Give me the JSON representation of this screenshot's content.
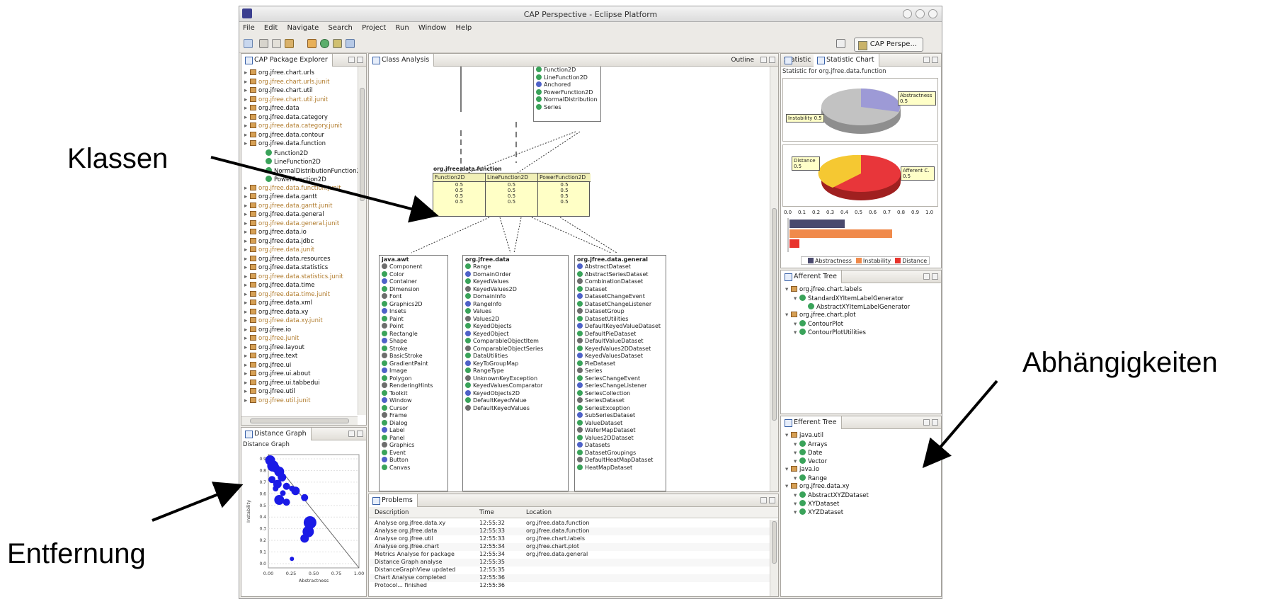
{
  "callouts": {
    "classes": "Klassen",
    "dependencies": "Abhängigkeiten",
    "distance": "Entfernung"
  },
  "window": {
    "title": "CAP Perspective - Eclipse Platform",
    "menu": [
      "File",
      "Edit",
      "Navigate",
      "Search",
      "Project",
      "Run",
      "Window",
      "Help"
    ],
    "perspective_button": "CAP Perspe..."
  },
  "package_explorer": {
    "tab": "CAP Package Explorer",
    "items": [
      {
        "label": "org.jfree.chart.urls",
        "kind": "package"
      },
      {
        "label": "org.jfree.chart.urls.junit",
        "kind": "package"
      },
      {
        "label": "org.jfree.chart.util",
        "kind": "package"
      },
      {
        "label": "org.jfree.chart.util.junit",
        "kind": "package"
      },
      {
        "label": "org.jfree.data",
        "kind": "package"
      },
      {
        "label": "org.jfree.data.category",
        "kind": "package"
      },
      {
        "label": "org.jfree.data.category.junit",
        "kind": "package"
      },
      {
        "label": "org.jfree.data.contour",
        "kind": "package"
      },
      {
        "label": "org.jfree.data.function",
        "kind": "package"
      },
      {
        "label": "Function2D",
        "kind": "class"
      },
      {
        "label": "LineFunction2D",
        "kind": "class"
      },
      {
        "label": "NormalDistributionFunction2D",
        "kind": "class"
      },
      {
        "label": "PowerFunction2D",
        "kind": "class"
      },
      {
        "label": "org.jfree.data.function.junit",
        "kind": "package"
      },
      {
        "label": "org.jfree.data.gantt",
        "kind": "package"
      },
      {
        "label": "org.jfree.data.gantt.junit",
        "kind": "package"
      },
      {
        "label": "org.jfree.data.general",
        "kind": "package"
      },
      {
        "label": "org.jfree.data.general.junit",
        "kind": "package"
      },
      {
        "label": "org.jfree.data.io",
        "kind": "package"
      },
      {
        "label": "org.jfree.data.jdbc",
        "kind": "package"
      },
      {
        "label": "org.jfree.data.junit",
        "kind": "package"
      },
      {
        "label": "org.jfree.data.resources",
        "kind": "package"
      },
      {
        "label": "org.jfree.data.statistics",
        "kind": "package"
      },
      {
        "label": "org.jfree.data.statistics.junit",
        "kind": "package"
      },
      {
        "label": "org.jfree.data.time",
        "kind": "package"
      },
      {
        "label": "org.jfree.data.time.junit",
        "kind": "package"
      },
      {
        "label": "org.jfree.data.xml",
        "kind": "package"
      },
      {
        "label": "org.jfree.data.xy",
        "kind": "package"
      },
      {
        "label": "org.jfree.data.xy.junit",
        "kind": "package"
      },
      {
        "label": "org.jfree.io",
        "kind": "package"
      },
      {
        "label": "org.jfree.junit",
        "kind": "package"
      },
      {
        "label": "org.jfree.layout",
        "kind": "package"
      },
      {
        "label": "org.jfree.text",
        "kind": "package"
      },
      {
        "label": "org.jfree.ui",
        "kind": "package"
      },
      {
        "label": "org.jfree.ui.about",
        "kind": "package"
      },
      {
        "label": "org.jfree.ui.tabbedui",
        "kind": "package"
      },
      {
        "label": "org.jfree.util",
        "kind": "package"
      },
      {
        "label": "org.jfree.util.junit",
        "kind": "package"
      }
    ]
  },
  "class_analysis": {
    "tab": "Class Analysis",
    "toolbar_label": "Outline",
    "top_box": [
      "Function2D",
      "LineFunction2D",
      "Anchored",
      "PowerFunction2D",
      "NormalDistribution",
      "Series"
    ],
    "center_box": {
      "title": "org.jfree.data.function",
      "columns": [
        {
          "header": "Function2D",
          "values": [
            "0.5",
            "0.5",
            "0.5",
            "0.5"
          ]
        },
        {
          "header": "LineFunction2D",
          "values": [
            "0.5",
            "0.5",
            "0.5",
            "0.5"
          ]
        },
        {
          "header": "PowerFunction2D",
          "values": [
            "0.5",
            "0.5",
            "0.5",
            "0.5"
          ]
        }
      ]
    },
    "bottom_boxes": [
      {
        "title": "java.awt",
        "items": [
          "Component",
          "Color",
          "Container",
          "Dimension",
          "Font",
          "Graphics2D",
          "Insets",
          "Paint",
          "Point",
          "Rectangle",
          "Shape",
          "Stroke",
          "BasicStroke",
          "GradientPaint",
          "Image",
          "Polygon",
          "RenderingHints",
          "Toolkit",
          "Window",
          "Cursor",
          "Frame",
          "Dialog",
          "Label",
          "Panel",
          "Graphics",
          "Event",
          "Button",
          "Canvas"
        ]
      },
      {
        "title": "org.jfree.data",
        "items": [
          "Range",
          "DomainOrder",
          "KeyedValues",
          "KeyedValues2D",
          "DomainInfo",
          "RangeInfo",
          "Values",
          "Values2D",
          "KeyedObjects",
          "KeyedObject",
          "ComparableObjectItem",
          "ComparableObjectSeries",
          "DataUtilities",
          "KeyToGroupMap",
          "RangeType",
          "UnknownKeyException",
          "KeyedValuesComparator",
          "KeyedObjects2D",
          "DefaultKeyedValue",
          "DefaultKeyedValues"
        ]
      },
      {
        "title": "org.jfree.data.general",
        "items": [
          "AbstractDataset",
          "AbstractSeriesDataset",
          "CombinationDataset",
          "Dataset",
          "DatasetChangeEvent",
          "DatasetChangeListener",
          "DatasetGroup",
          "DatasetUtilities",
          "DefaultKeyedValueDataset",
          "DefaultPieDataset",
          "DefaultValueDataset",
          "KeyedValues2DDataset",
          "KeyedValuesDataset",
          "PieDataset",
          "Series",
          "SeriesChangeEvent",
          "SeriesChangeListener",
          "SeriesCollection",
          "SeriesDataset",
          "SeriesException",
          "SubSeriesDataset",
          "ValueDataset",
          "WaferMapDataset",
          "Values2DDataset",
          "Datasets",
          "DatasetGroupings",
          "DefaultHeatMapDataset",
          "HeatMapDataset"
        ]
      }
    ]
  },
  "statistic_chart": {
    "tabs": [
      "Statistic",
      "Statistic Chart"
    ],
    "subtitle": "Statistic for org.jfree.data.function",
    "pie1_labels": [
      "Abstractness 0.5",
      "Instability 0.5"
    ],
    "pie2_labels": [
      "Distance 0.5",
      "Afferent C. 0.5"
    ],
    "bar_axis": [
      "0.0",
      "0.1",
      "0.2",
      "0.3",
      "0.4",
      "0.5",
      "0.6",
      "0.7",
      "0.8",
      "0.9",
      "1.0"
    ],
    "legend": [
      {
        "label": "Abstractness",
        "color": "#4a4a6e"
      },
      {
        "label": "Instability",
        "color": "#f08a4b"
      },
      {
        "label": "Distance",
        "color": "#e8332c"
      }
    ]
  },
  "afferent_tree": {
    "tab": "Afferent Tree",
    "rows": [
      {
        "label": "org.jfree.chart.labels",
        "level": 0
      },
      {
        "label": "StandardXYItemLabelGenerator",
        "level": 1
      },
      {
        "label": "AbstractXYItemLabelGenerator",
        "level": 2
      },
      {
        "label": "org.jfree.chart.plot",
        "level": 0
      },
      {
        "label": "ContourPlot",
        "level": 1
      },
      {
        "label": "ContourPlotUtilities",
        "level": 1
      }
    ]
  },
  "efferent_tree": {
    "tab": "Efferent Tree",
    "rows": [
      {
        "label": "java.util",
        "level": 0
      },
      {
        "label": "Arrays",
        "level": 1
      },
      {
        "label": "Date",
        "level": 1
      },
      {
        "label": "Vector",
        "level": 1
      },
      {
        "label": "java.io",
        "level": 0
      },
      {
        "label": "Range",
        "level": 1
      },
      {
        "label": "org.jfree.data.xy",
        "level": 0
      },
      {
        "label": "AbstractXYZDataset",
        "level": 1
      },
      {
        "label": "XYDataset",
        "level": 1
      },
      {
        "label": "XYZDataset",
        "level": 1
      }
    ]
  },
  "distance_graph": {
    "tab": "Distance Graph",
    "title": "Distance Graph",
    "x_ticks": [
      "0.00",
      "0.25",
      "0.50",
      "0.75",
      "1.00"
    ],
    "y_ticks": [
      "0.9",
      "0.8",
      "0.7",
      "0.6",
      "0.5",
      "0.4",
      "0.3",
      "0.2",
      "0.1",
      "0.0"
    ],
    "xlabel": "Abstractness",
    "ylabel": "Instability"
  },
  "problems": {
    "tab": "Problems",
    "headers": [
      "Description",
      "Time",
      "Location"
    ],
    "rows": [
      [
        "Analyse org.jfree.data.xy",
        "12:55:32",
        "org.jfree.data.function"
      ],
      [
        "Analyse org.jfree.data",
        "12:55:33",
        "org.jfree.data.function"
      ],
      [
        "Analyse org.jfree.util",
        "12:55:33",
        "org.jfree.chart.labels"
      ],
      [
        "Analyse org.jfree.chart",
        "12:55:34",
        "org.jfree.chart.plot"
      ],
      [
        "Metrics Analyse for package",
        "12:55:34",
        "org.jfree.data.general"
      ],
      [
        "Distance Graph analyse",
        "12:55:35",
        ""
      ],
      [
        "DistanceGraphView updated",
        "12:55:35",
        ""
      ],
      [
        "Chart Analyse completed",
        "12:55:36",
        ""
      ],
      [
        "Protocol... finished",
        "12:55:36",
        ""
      ]
    ]
  }
}
